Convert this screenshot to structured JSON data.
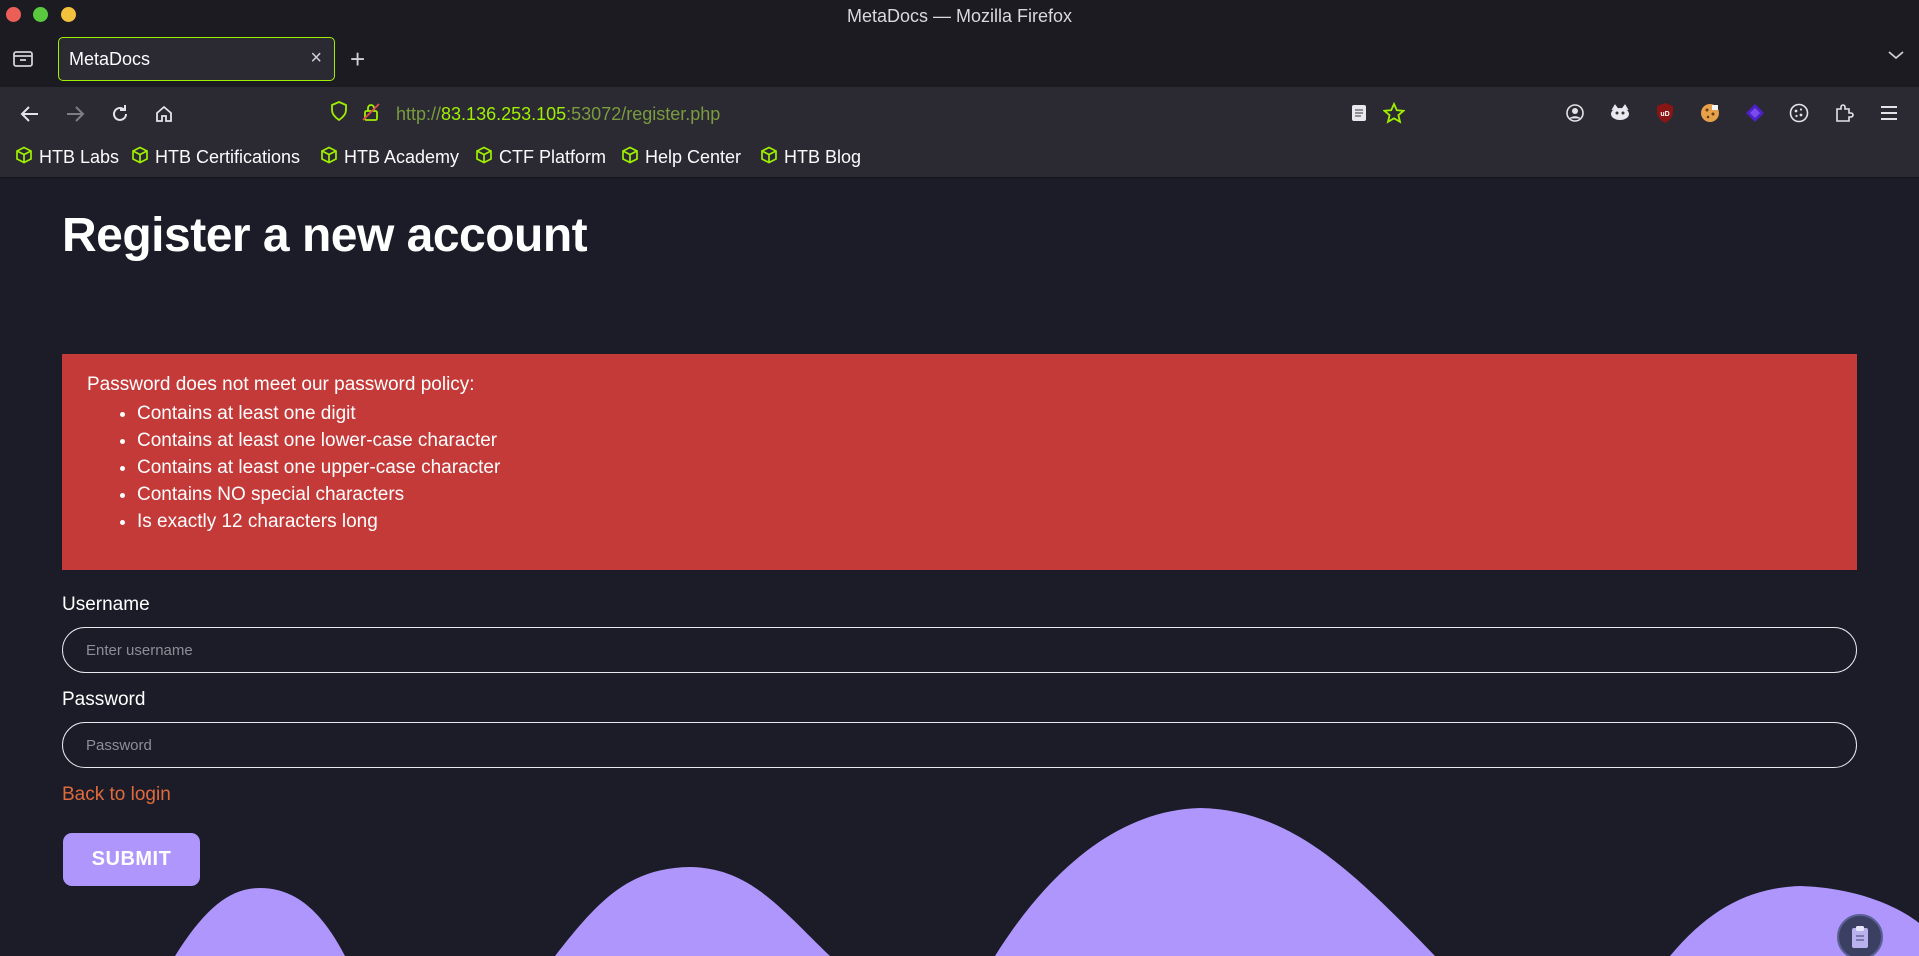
{
  "window": {
    "title": "MetaDocs — Mozilla Firefox"
  },
  "tab": {
    "title": "MetaDocs",
    "close": "×"
  },
  "newtab": {
    "label": "+"
  },
  "url": {
    "scheme": "http://",
    "host": "83.136.253.105",
    "rest": ":53072/register.php"
  },
  "bookmarks": [
    {
      "label": "HTB Labs"
    },
    {
      "label": "HTB Certifications"
    },
    {
      "label": "HTB Academy"
    },
    {
      "label": "CTF Platform"
    },
    {
      "label": "Help Center"
    },
    {
      "label": "HTB Blog"
    }
  ],
  "page": {
    "title": "Register a new account",
    "alert": {
      "intro": "Password does not meet our password policy:",
      "rules": [
        "Contains at least one digit",
        "Contains at least one lower-case character",
        "Contains at least one upper-case character",
        "Contains NO special characters",
        "Is exactly 12 characters long"
      ]
    },
    "username": {
      "label": "Username",
      "placeholder": "Enter username",
      "value": ""
    },
    "password": {
      "label": "Password",
      "placeholder": "Password",
      "value": ""
    },
    "back_link": "Back to login",
    "submit": "SUBMIT"
  },
  "colors": {
    "accent": "#9fef00",
    "alert_bg": "#c43a39",
    "link": "#e16a3d",
    "button": "#ae96fc",
    "page_bg": "#1b1c27"
  },
  "icons": [
    "tab-list-icon",
    "back-arrow-icon",
    "forward-arrow-icon",
    "reload-icon",
    "home-icon",
    "shield-icon",
    "insecure-lock-icon",
    "reader-view-icon",
    "bookmark-star-icon",
    "account-icon",
    "extension-icons",
    "menu-icon",
    "clipboard-icon"
  ]
}
